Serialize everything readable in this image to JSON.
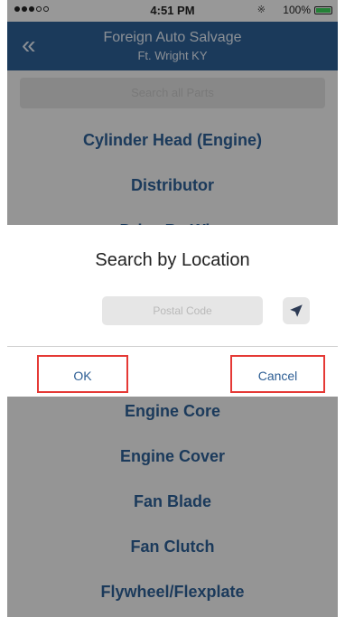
{
  "status_bar": {
    "time": "4:51 PM",
    "battery": "100%"
  },
  "header": {
    "title": "Foreign Auto Salvage",
    "subtitle": "Ft. Wright KY",
    "back_icon": "double-chevron-left-icon"
  },
  "search": {
    "label": "Search all Parts"
  },
  "parts_list": {
    "items_top": [
      "Cylinder Head (Engine)",
      "Distributor",
      "Drive By Wire"
    ],
    "items_bottom": [
      "Engine Core",
      "Engine Cover",
      "Fan Blade",
      "Fan Clutch",
      "Flywheel/Flexplate"
    ]
  },
  "dialog": {
    "title": "Search by Location",
    "postal_placeholder": "Postal Code",
    "location_icon": "location-arrow-icon",
    "ok_label": "OK",
    "cancel_label": "Cancel"
  },
  "colors": {
    "nav_bg": "#2d5e94",
    "link_text": "#2d5e94",
    "highlight_border": "#e53935"
  }
}
